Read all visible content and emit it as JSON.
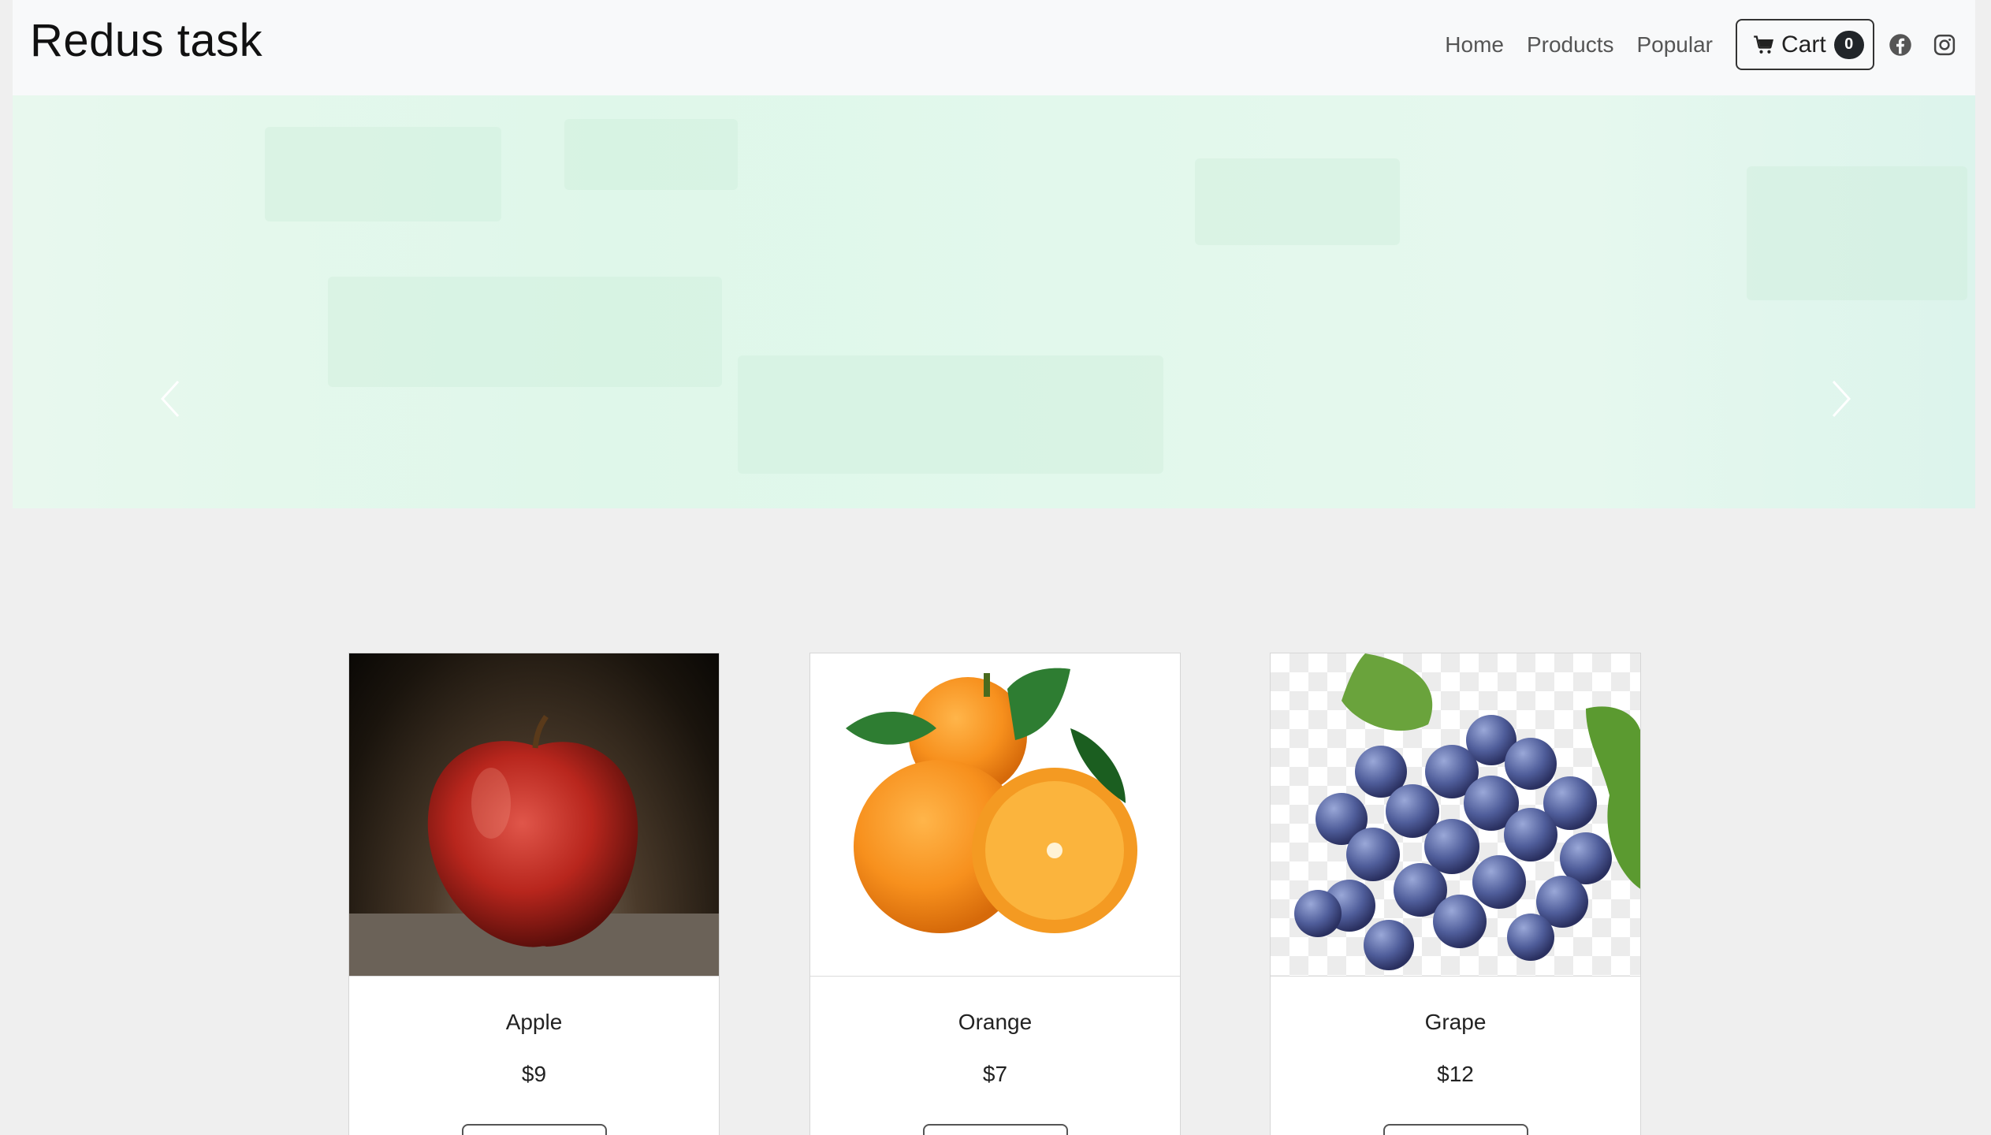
{
  "header": {
    "brand": "Redus task",
    "nav": [
      "Home",
      "Products",
      "Popular"
    ],
    "cart_label": "Cart",
    "cart_count": "0",
    "icons": [
      "cart-icon",
      "facebook-icon",
      "instagram-icon"
    ]
  },
  "carousel": {
    "prev_icon": "chevron-left-icon",
    "next_icon": "chevron-right-icon"
  },
  "products": [
    {
      "name": "Apple",
      "price": "$9"
    },
    {
      "name": "Orange",
      "price": "$7"
    },
    {
      "name": "Grape",
      "price": "$12"
    }
  ]
}
